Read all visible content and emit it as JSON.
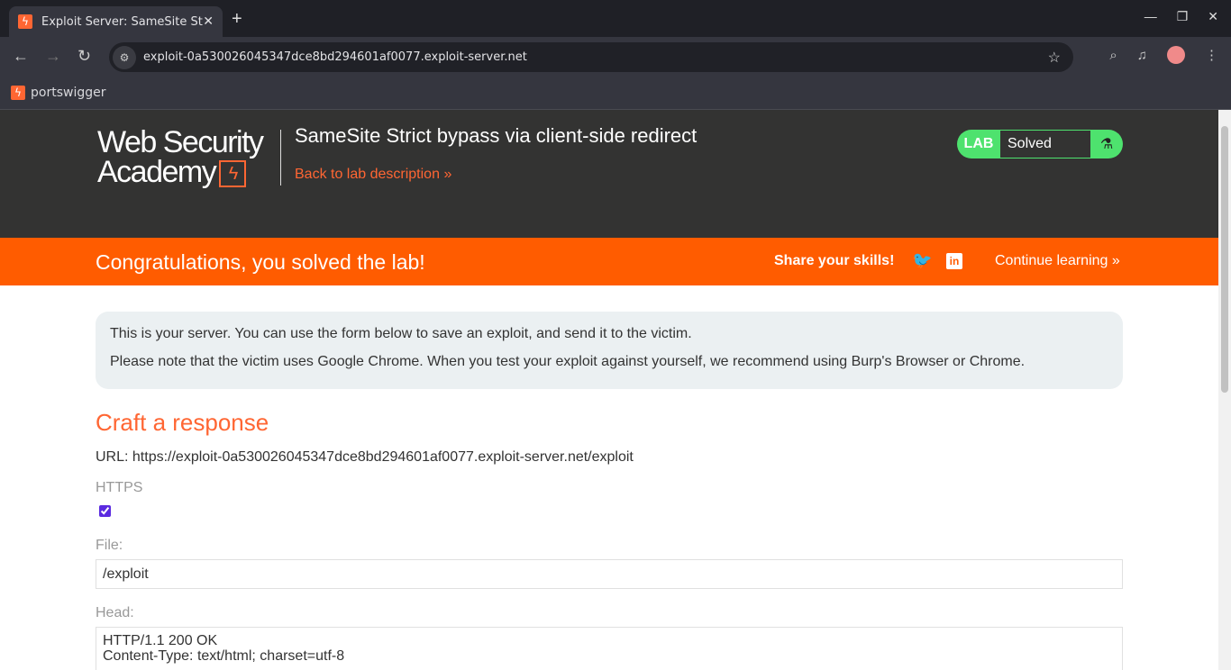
{
  "browser": {
    "tab_title": "Exploit Server: SameSite Strict bypass via client-side redirect",
    "url": "exploit-0a530026045347dce8bd294601af0077.exploit-server.net",
    "bookmark": "portswigger"
  },
  "header": {
    "logo_line1": "Web Security",
    "logo_line2": "Academy",
    "lab_title": "SameSite Strict bypass via client-side redirect",
    "back_link": "Back to lab description",
    "badge_lab": "LAB",
    "badge_status": "Solved"
  },
  "banner": {
    "message": "Congratulations, you solved the lab!",
    "share": "Share your skills!",
    "continue": "Continue learning"
  },
  "info": {
    "line1": "This is your server. You can use the form below to save an exploit, and send it to the victim.",
    "line2": "Please note that the victim uses Google Chrome. When you test your exploit against yourself, we recommend using Burp's Browser or Chrome."
  },
  "form": {
    "heading": "Craft a response",
    "url_line": "URL: https://exploit-0a530026045347dce8bd294601af0077.exploit-server.net/exploit",
    "https_label": "HTTPS",
    "https_checked": true,
    "file_label": "File:",
    "file_value": "/exploit",
    "head_label": "Head:",
    "head_value": "HTTP/1.1 200 OK\nContent-Type: text/html; charset=utf-8"
  },
  "colors": {
    "accent": "#ff6633",
    "banner": "#ff5c00",
    "solved": "#4ee26e",
    "header_bg": "#333332"
  }
}
